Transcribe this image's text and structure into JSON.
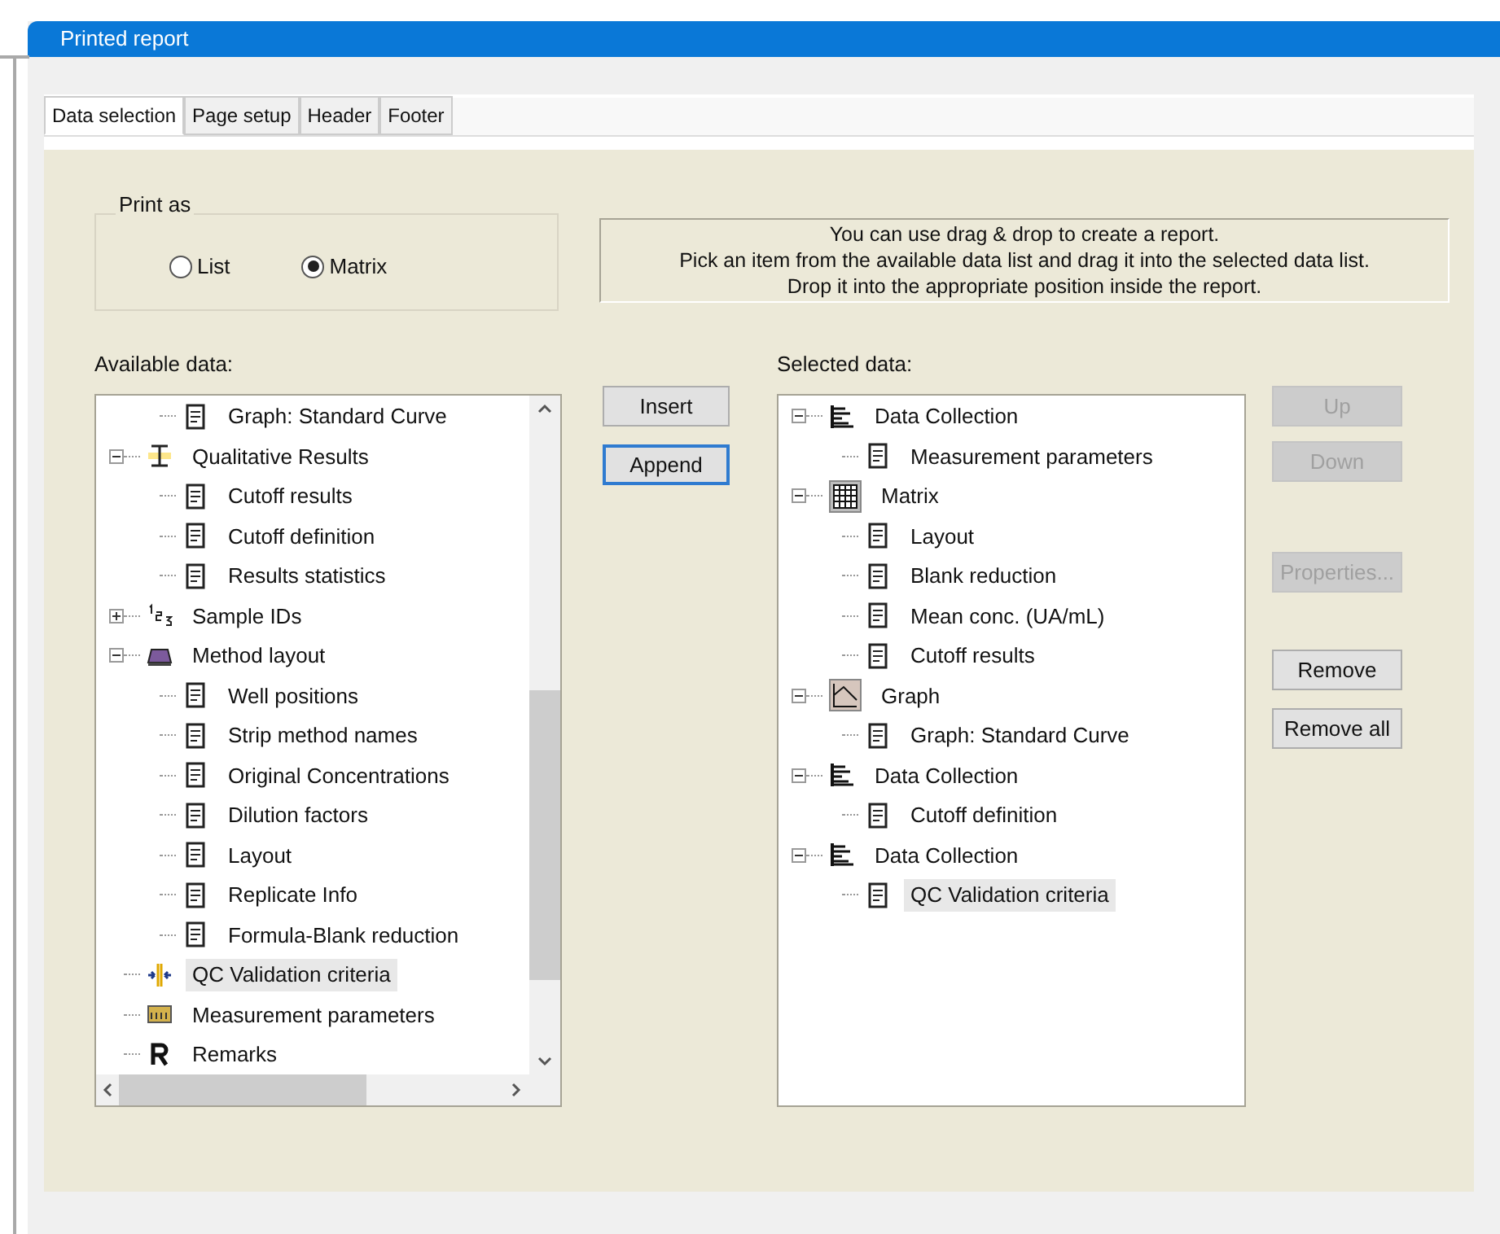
{
  "window": {
    "title": "Printed report"
  },
  "tabs": [
    {
      "label": "Data selection",
      "selected": true
    },
    {
      "label": "Page setup",
      "selected": false
    },
    {
      "label": "Header",
      "selected": false
    },
    {
      "label": "Footer",
      "selected": false
    }
  ],
  "print_as": {
    "title": "Print as",
    "options": [
      {
        "label": "List",
        "selected": false
      },
      {
        "label": "Matrix",
        "selected": true
      }
    ]
  },
  "info": [
    "You can use drag & drop to create a report.",
    "Pick an item from the available data list and drag it into the selected data list.",
    "Drop it into the appropriate position inside the report."
  ],
  "available_data": {
    "label": "Available data:",
    "children_of_hidden_parent": [
      {
        "label": "Graph: Standard Curve",
        "kind": "document",
        "selected": false
      }
    ],
    "items": [
      {
        "label": "Qualitative Results",
        "kind": "range",
        "selected": false,
        "expanded": true,
        "children": [
          {
            "label": "Cutoff results",
            "kind": "document",
            "selected": false
          },
          {
            "label": "Cutoff definition",
            "kind": "document",
            "selected": false
          },
          {
            "label": "Results statistics",
            "kind": "document",
            "selected": false
          }
        ]
      },
      {
        "label": "Sample IDs",
        "kind": "numbers",
        "selected": false,
        "expanded": false
      },
      {
        "label": "Method layout",
        "kind": "plate",
        "selected": false,
        "expanded": true,
        "children": [
          {
            "label": "Well positions",
            "kind": "document",
            "selected": false
          },
          {
            "label": "Strip method names",
            "kind": "document",
            "selected": false
          },
          {
            "label": "Original Concentrations",
            "kind": "document",
            "selected": false
          },
          {
            "label": "Dilution factors",
            "kind": "document",
            "selected": false
          },
          {
            "label": "Layout",
            "kind": "document",
            "selected": false
          },
          {
            "label": "Replicate Info",
            "kind": "document",
            "selected": false
          },
          {
            "label": "Formula-Blank reduction",
            "kind": "document",
            "selected": false
          }
        ]
      },
      {
        "label": "QC Validation criteria",
        "kind": "arrows",
        "selected": true
      },
      {
        "label": "Measurement parameters",
        "kind": "meter",
        "selected": false
      },
      {
        "label": "Remarks",
        "kind": "letter",
        "selected": false
      }
    ]
  },
  "middle_buttons": [
    {
      "label": "Insert",
      "focused": false
    },
    {
      "label": "Append",
      "focused": true
    }
  ],
  "selected_data": {
    "label": "Selected data:",
    "items": [
      {
        "label": "Data Collection",
        "kind": "bars",
        "selected": false,
        "expanded": true,
        "children": [
          {
            "label": "Measurement parameters",
            "kind": "document",
            "selected": false
          }
        ]
      },
      {
        "label": "Matrix",
        "kind": "grid",
        "selected": false,
        "expanded": true,
        "children": [
          {
            "label": "Layout",
            "kind": "document",
            "selected": false
          },
          {
            "label": "Blank reduction",
            "kind": "document",
            "selected": false
          },
          {
            "label": "Mean conc. (UA/mL)",
            "kind": "document",
            "selected": false
          },
          {
            "label": "Cutoff results",
            "kind": "document",
            "selected": false
          }
        ]
      },
      {
        "label": "Graph",
        "kind": "chart",
        "selected": false,
        "expanded": true,
        "children": [
          {
            "label": "Graph: Standard Curve",
            "kind": "document",
            "selected": false
          }
        ]
      },
      {
        "label": "Data Collection",
        "kind": "bars",
        "selected": false,
        "expanded": true,
        "children": [
          {
            "label": "Cutoff definition",
            "kind": "document",
            "selected": false
          }
        ]
      },
      {
        "label": "Data Collection",
        "kind": "bars",
        "selected": false,
        "expanded": true,
        "children": [
          {
            "label": "QC Validation criteria",
            "kind": "document",
            "selected": true
          }
        ]
      }
    ]
  },
  "side_buttons": [
    {
      "label": "Up",
      "disabled": true
    },
    {
      "label": "Down",
      "disabled": true
    },
    {
      "label": "Properties...",
      "disabled": true
    },
    {
      "label": "Remove",
      "disabled": false
    },
    {
      "label": "Remove all",
      "disabled": false
    }
  ]
}
